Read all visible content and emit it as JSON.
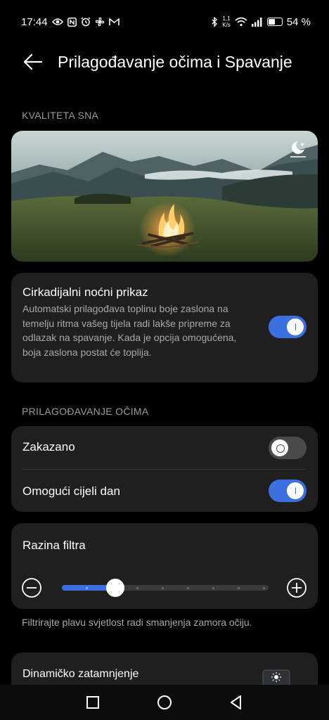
{
  "status_bar": {
    "time": "17:44",
    "left_icons": [
      "eye-icon",
      "nfc-icon",
      "alarm-icon",
      "fan-icon",
      "gmail-icon"
    ],
    "speed_top": "1,1",
    "speed_bottom": "K/s",
    "battery_text": "54 %",
    "battery_level": 0.54
  },
  "header": {
    "title": "Prilagođavanje očima i Spavanje"
  },
  "sleep_section": {
    "label": "KVALITETA SNA"
  },
  "circadian": {
    "title": "Cirkadijalni noćni prikaz",
    "description": "Automatski prilagođava toplinu boje zaslona na temelju ritma vašeg tijela radi lakše pripreme za odlazak na spavanje. Kada je opcija omogućena, boja zaslona postat će toplija.",
    "enabled": true
  },
  "eye_section": {
    "label": "PRILAGOĐAVANJE OČIMA"
  },
  "eye_settings": {
    "scheduled_label": "Zakazano",
    "scheduled_enabled": false,
    "all_day_label": "Omogući cijeli dan",
    "all_day_enabled": true
  },
  "filter": {
    "title": "Razina filtra",
    "level": 0.26,
    "helper": "Filtrirajte plavu svjetlost radi smanjenja zamora očiju."
  },
  "dynamic": {
    "title": "Dinamičko zatamnjenje"
  },
  "colors": {
    "accent": "#3c6fe0",
    "card": "#1f1f1f",
    "background": "#000000"
  }
}
